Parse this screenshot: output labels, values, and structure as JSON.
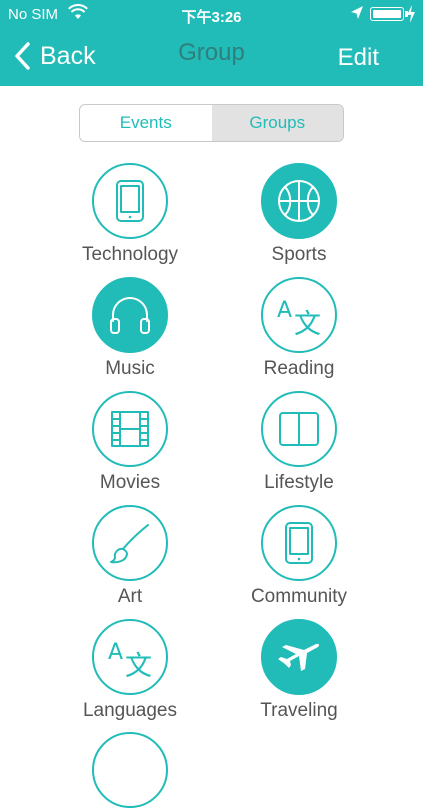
{
  "status": {
    "carrier": "No SIM",
    "time": "下午3:26"
  },
  "nav": {
    "back_label": "Back",
    "title": "Group",
    "edit_label": "Edit"
  },
  "tabs": [
    {
      "label": "Events",
      "active": false
    },
    {
      "label": "Groups",
      "active": true
    }
  ],
  "categories": [
    {
      "label": "Technology",
      "icon": "tablet-icon",
      "selected": false
    },
    {
      "label": "Sports",
      "icon": "basketball-icon",
      "selected": true
    },
    {
      "label": "Music",
      "icon": "headphones-icon",
      "selected": true
    },
    {
      "label": "Reading",
      "icon": "translate-icon",
      "selected": false
    },
    {
      "label": "Movies",
      "icon": "film-icon",
      "selected": false
    },
    {
      "label": "Lifestyle",
      "icon": "book-icon",
      "selected": false
    },
    {
      "label": "Art",
      "icon": "paintbrush-icon",
      "selected": false
    },
    {
      "label": "Community",
      "icon": "tablet-icon",
      "selected": false
    },
    {
      "label": "Languages",
      "icon": "translate-icon",
      "selected": false
    },
    {
      "label": "Traveling",
      "icon": "airplane-icon",
      "selected": true
    }
  ],
  "colors": {
    "accent": "#21bcb8",
    "title": "#2f7f7c",
    "label": "#555555"
  }
}
